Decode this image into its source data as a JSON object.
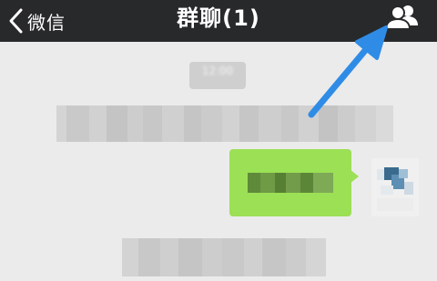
{
  "navbar": {
    "back_label": "微信",
    "title": "群聊(1)"
  },
  "chat": {
    "timestamp": "12:00",
    "messages": [
      {
        "type": "system",
        "text": ""
      },
      {
        "type": "outgoing",
        "text": ""
      },
      {
        "type": "system",
        "text": ""
      }
    ]
  },
  "colors": {
    "navbar_bg": "#28292b",
    "chat_bg": "#ebebeb",
    "bubble_out": "#9be055",
    "arrow": "#2f8ce6"
  },
  "icons": {
    "back": "chevron-left-icon",
    "members": "group-members-icon"
  }
}
